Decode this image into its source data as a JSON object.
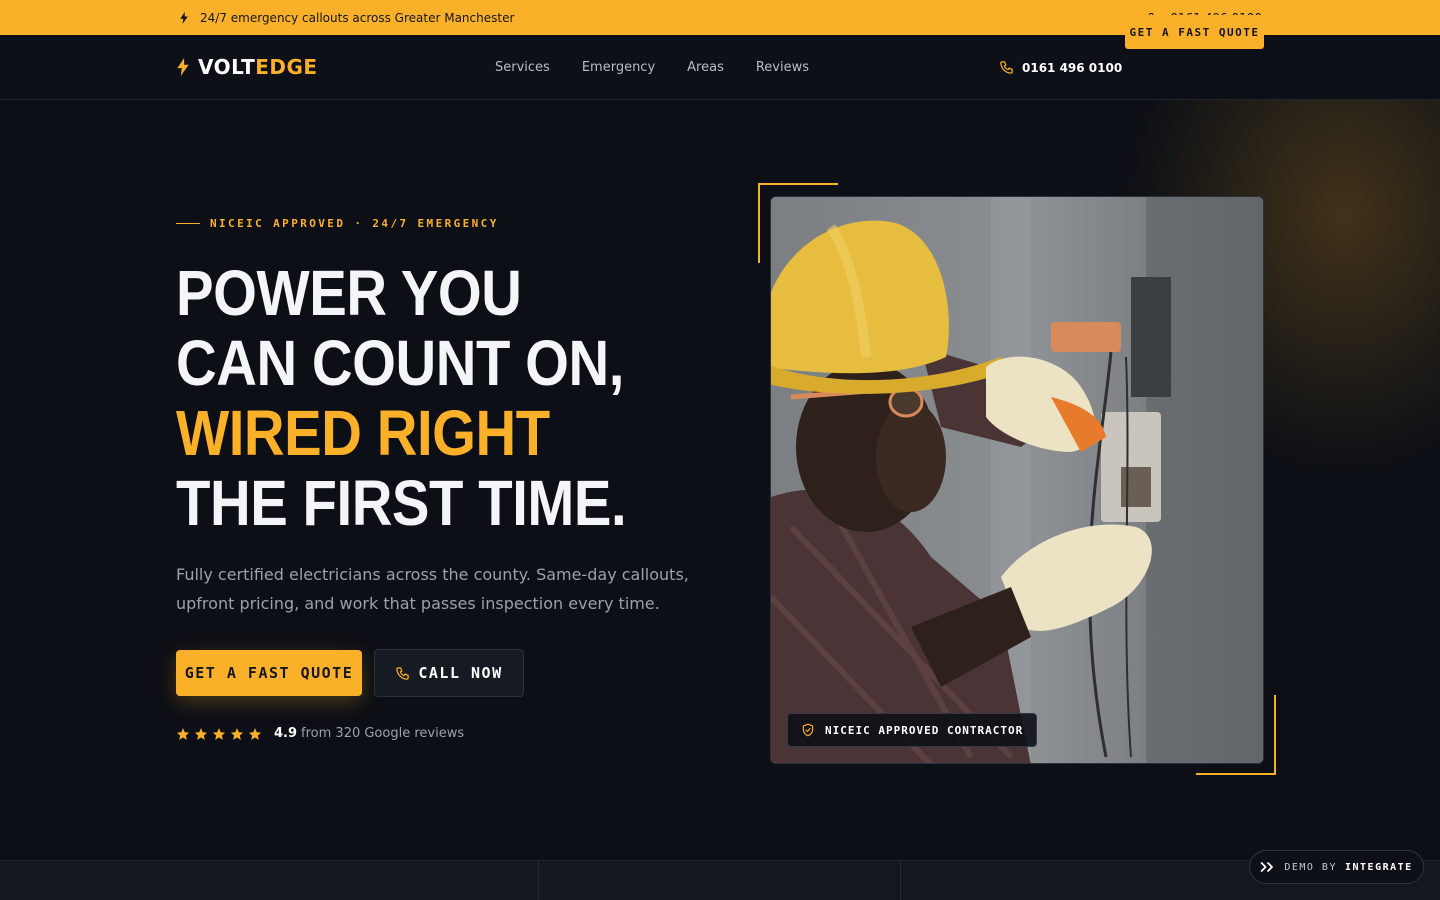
{
  "topbar": {
    "announcement": "24/7 emergency callouts across Greater Manchester",
    "phone": "0161 496 0100",
    "bolt_icon": "bolt-icon",
    "phone_icon": "phone-icon"
  },
  "nav": {
    "logo_part1": "VOLT",
    "logo_part2": "EDGE",
    "links": [
      "Services",
      "Emergency",
      "Areas",
      "Reviews"
    ],
    "phone": "0161 496 0100",
    "cta": "GET A FAST QUOTE"
  },
  "hero": {
    "eyebrow": "NICEIC APPROVED · 24/7 EMERGENCY",
    "headline_1": "POWER YOU CAN COUNT ON, ",
    "headline_2": "WIRED RIGHT",
    "headline_3": " THE FIRST TIME.",
    "subtext": "Fully certified electricians across the county. Same-day callouts, upfront pricing, and work that passes inspection every time.",
    "primary_cta": "GET A FAST QUOTE",
    "secondary_cta": "CALL NOW",
    "rating_score": "4.9",
    "rating_text": "from 320 Google reviews",
    "stars": 5,
    "badge": "NICEIC APPROVED CONTRACTOR"
  },
  "demo": {
    "prefix": "DEMO BY",
    "brand": "INTEGRATE"
  },
  "colors": {
    "accent": "#fbb02a",
    "background": "#0c0f15",
    "text": "#e6e8ee",
    "muted": "#9aa1ad"
  }
}
